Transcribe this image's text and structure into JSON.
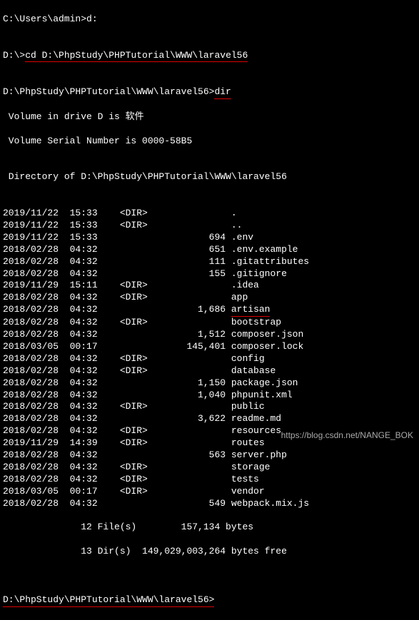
{
  "lines": {
    "l0": "C:\\Users\\admin>d:",
    "l1": "",
    "l2_prompt": "D:\\>",
    "l2_cmd": "cd D:\\PhpStudy\\PHPTutorial\\WWW\\laravel56",
    "l3": "",
    "l4_prompt": "D:\\PhpStudy\\PHPTutorial\\WWW\\laravel56>",
    "l4_cmd": "dir",
    "l5": " Volume in drive D is 软件",
    "l6": " Volume Serial Number is 0000-58B5",
    "l7": "",
    "l8": " Directory of D:\\PhpStudy\\PHPTutorial\\WWW\\laravel56",
    "l9": ""
  },
  "entries": [
    {
      "date": "2019/11/22",
      "time": "15:33",
      "dir": "<DIR>",
      "size": "",
      "name": "."
    },
    {
      "date": "2019/11/22",
      "time": "15:33",
      "dir": "<DIR>",
      "size": "",
      "name": ".."
    },
    {
      "date": "2019/11/22",
      "time": "15:33",
      "dir": "",
      "size": "694",
      "name": ".env"
    },
    {
      "date": "2018/02/28",
      "time": "04:32",
      "dir": "",
      "size": "651",
      "name": ".env.example"
    },
    {
      "date": "2018/02/28",
      "time": "04:32",
      "dir": "",
      "size": "111",
      "name": ".gitattributes"
    },
    {
      "date": "2018/02/28",
      "time": "04:32",
      "dir": "",
      "size": "155",
      "name": ".gitignore"
    },
    {
      "date": "2019/11/29",
      "time": "15:11",
      "dir": "<DIR>",
      "size": "",
      "name": ".idea"
    },
    {
      "date": "2018/02/28",
      "time": "04:32",
      "dir": "<DIR>",
      "size": "",
      "name": "app"
    },
    {
      "date": "2018/02/28",
      "time": "04:32",
      "dir": "",
      "size": "1,686",
      "name": "artisan",
      "hl": true
    },
    {
      "date": "2018/02/28",
      "time": "04:32",
      "dir": "<DIR>",
      "size": "",
      "name": "bootstrap"
    },
    {
      "date": "2018/02/28",
      "time": "04:32",
      "dir": "",
      "size": "1,512",
      "name": "composer.json"
    },
    {
      "date": "2018/03/05",
      "time": "00:17",
      "dir": "",
      "size": "145,401",
      "name": "composer.lock"
    },
    {
      "date": "2018/02/28",
      "time": "04:32",
      "dir": "<DIR>",
      "size": "",
      "name": "config"
    },
    {
      "date": "2018/02/28",
      "time": "04:32",
      "dir": "<DIR>",
      "size": "",
      "name": "database"
    },
    {
      "date": "2018/02/28",
      "time": "04:32",
      "dir": "",
      "size": "1,150",
      "name": "package.json"
    },
    {
      "date": "2018/02/28",
      "time": "04:32",
      "dir": "",
      "size": "1,040",
      "name": "phpunit.xml"
    },
    {
      "date": "2018/02/28",
      "time": "04:32",
      "dir": "<DIR>",
      "size": "",
      "name": "public"
    },
    {
      "date": "2018/02/28",
      "time": "04:32",
      "dir": "",
      "size": "3,622",
      "name": "readme.md"
    },
    {
      "date": "2018/02/28",
      "time": "04:32",
      "dir": "<DIR>",
      "size": "",
      "name": "resources"
    },
    {
      "date": "2019/11/29",
      "time": "14:39",
      "dir": "<DIR>",
      "size": "",
      "name": "routes"
    },
    {
      "date": "2018/02/28",
      "time": "04:32",
      "dir": "",
      "size": "563",
      "name": "server.php"
    },
    {
      "date": "2018/02/28",
      "time": "04:32",
      "dir": "<DIR>",
      "size": "",
      "name": "storage"
    },
    {
      "date": "2018/02/28",
      "time": "04:32",
      "dir": "<DIR>",
      "size": "",
      "name": "tests"
    },
    {
      "date": "2018/03/05",
      "time": "00:17",
      "dir": "<DIR>",
      "size": "",
      "name": "vendor"
    },
    {
      "date": "2018/02/28",
      "time": "04:32",
      "dir": "",
      "size": "549",
      "name": "webpack.mix.js"
    }
  ],
  "summary": {
    "files": "              12 File(s)        157,134 bytes",
    "dirs": "              13 Dir(s)  149,029,003,264 bytes free"
  },
  "final_prompt": "D:\\PhpStudy\\PHPTutorial\\WWW\\laravel56>",
  "watermark": "https://blog.csdn.net/NANGE_BOK"
}
